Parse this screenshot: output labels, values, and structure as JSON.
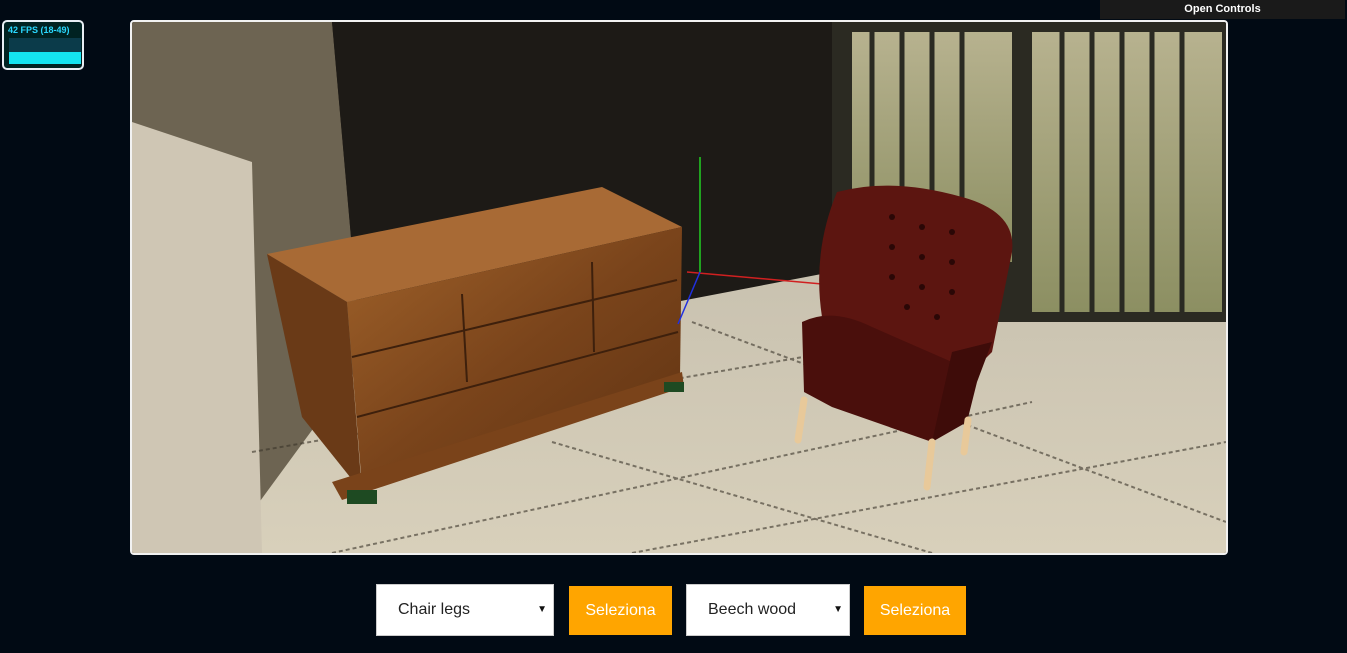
{
  "stats": {
    "fps_label": "42 FPS (18-49)"
  },
  "controls": {
    "open_label": "Open Controls"
  },
  "selectors": {
    "part_value": "Chair legs",
    "part_select_label": "Seleziona",
    "material_value": "Beech wood",
    "material_select_label": "Seleziona"
  },
  "icons": {
    "dropdown": "chevron-down-icon"
  },
  "colors": {
    "accent": "#ffa500",
    "background": "#010a14",
    "fps": "#2ad8ff"
  }
}
